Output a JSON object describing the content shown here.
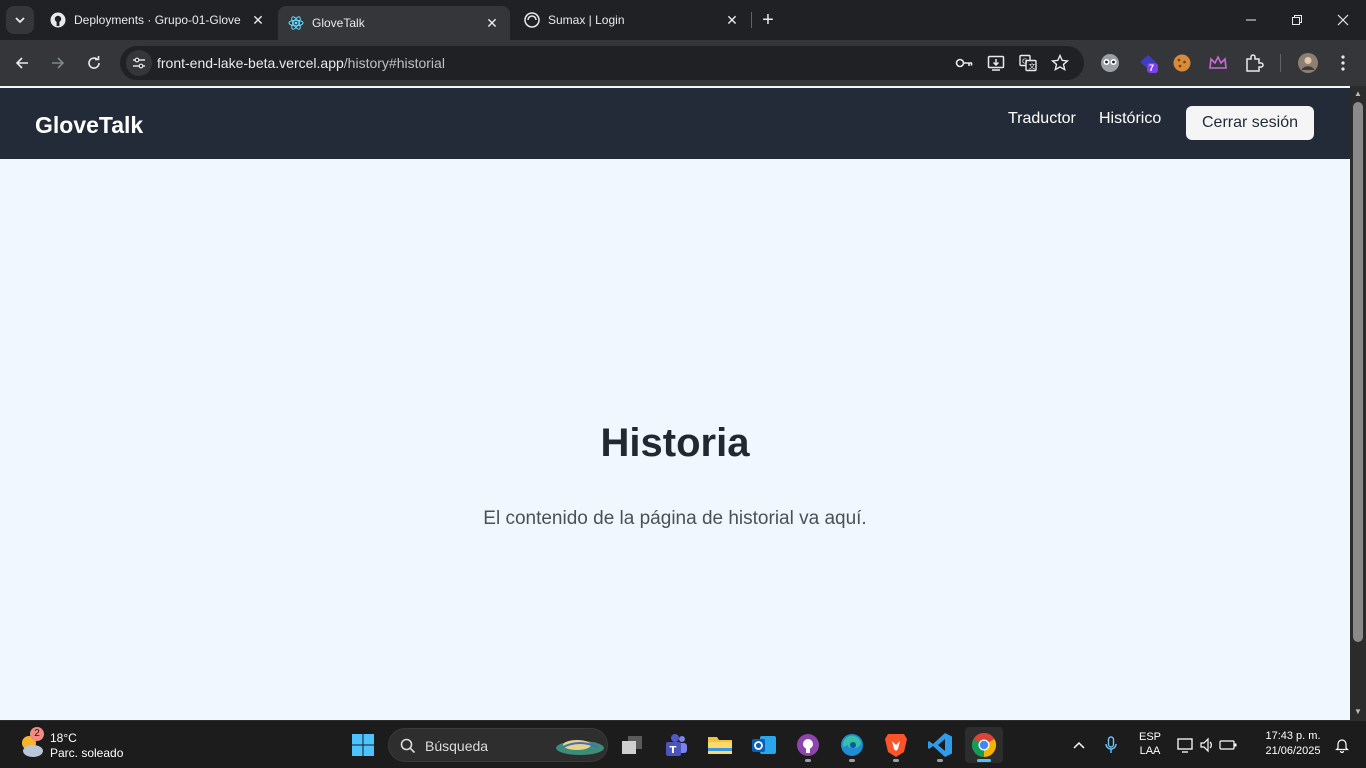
{
  "browser": {
    "tabs": [
      {
        "title": "Deployments · Grupo-01-Glove",
        "favicon": "github-icon",
        "active": false
      },
      {
        "title": "GloveTalk",
        "favicon": "react-icon",
        "active": true
      },
      {
        "title": "Sumax | Login",
        "favicon": "globe-icon",
        "active": false
      }
    ],
    "url_host": "front-end-lake-beta.vercel.app",
    "url_path": "/history#historial",
    "extension_badge": "7"
  },
  "app": {
    "brand": "GloveTalk",
    "nav": {
      "translator": "Traductor",
      "history": "Histórico",
      "logout": "Cerrar sesión"
    },
    "main": {
      "heading": "Historia",
      "description": "El contenido de la página de historial va aquí."
    }
  },
  "taskbar": {
    "weather": {
      "temp": "18°C",
      "desc": "Parc. soleado",
      "badge": "2"
    },
    "search_label": "Búsqueda",
    "lang": {
      "line1": "ESP",
      "line2": "LAA"
    },
    "time": "17:43 p. m.",
    "date": "21/06/2025"
  },
  "colors": {
    "nav_bg": "#242b38",
    "page_bg": "#f0f7ff",
    "heading": "#222831"
  }
}
